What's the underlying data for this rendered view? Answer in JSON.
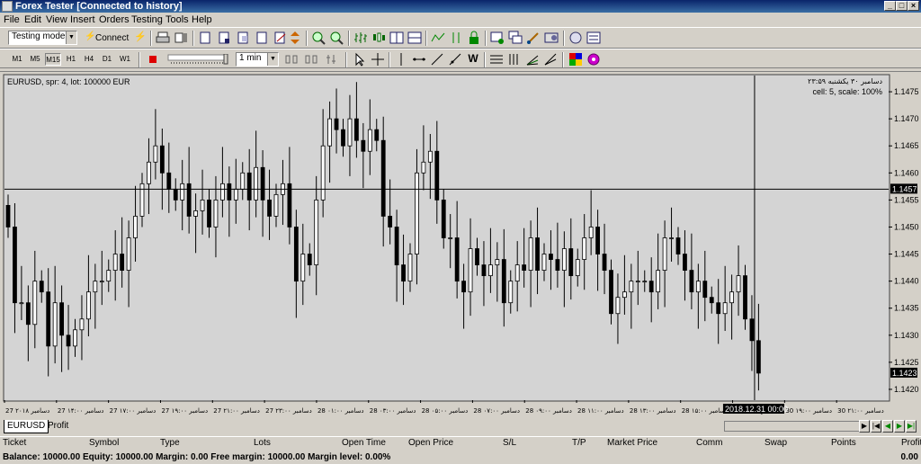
{
  "window": {
    "title": "Forex Tester [Connected to history]"
  },
  "menu": [
    "File",
    "Edit",
    "View",
    "Insert",
    "Orders",
    "Testing",
    "Tools",
    "Help"
  ],
  "toolbar": {
    "mode_select": "Testing mode",
    "connect_label": "Connect",
    "timeframes": [
      "M1",
      "M5",
      "M15",
      "H1",
      "H4",
      "D1",
      "W1"
    ],
    "active_timeframe": "M15",
    "speed_select": "1 min"
  },
  "chart": {
    "info_line": "EURUSD, spr: 4, lot: 100000 EUR",
    "cursor_date_line": "دسامبر ۳۰ یکشنبه ۲۳:۵۹",
    "cell_scale": "cell: 5, scale: 100%",
    "crosshair_price": "1.1457",
    "last_price": "1.1423",
    "crosshair_time": "2018.12.31 00:00",
    "colors": {
      "background": "#d4d4d4",
      "bull": "#ffffff",
      "bear": "#000000",
      "crosshair": "#000000"
    }
  },
  "chart_data": {
    "type": "candlestick",
    "symbol": "EURUSD",
    "ylim": [
      1.1418,
      1.1478
    ],
    "y_ticks": [
      "1.1475",
      "1.1470",
      "1.1465",
      "1.1460",
      "1.1455",
      "1.1450",
      "1.1445",
      "1.1440",
      "1.1435",
      "1.1430",
      "1.1425",
      "1.1420"
    ],
    "x_ticks": [
      "27 دسامبر ۲۰۱۸",
      "27 دسامبر ۱۴:۰۰",
      "27 دسامبر ۱۷:۰۰",
      "27 دسامبر ۱۹:۰۰",
      "27 دسامبر ۲۱:۰۰",
      "27 دسامبر ۲۳:۰۰",
      "28 دسامبر ۰۱:۰۰",
      "28 دسامبر ۰۳:۰۰",
      "28 دسامبر ۰۵:۰۰",
      "28 دسامبر ۰۷:۰۰",
      "28 دسامبر ۰۹:۰۰",
      "28 دسامبر ۱۱:۰۰",
      "28 دسامبر ۱۳:۰۰",
      "28 دسامبر ۱۵:۰۰",
      "30 دسامبر ۱۷:۰۰",
      "30 دسامبر ۱۹:۰۰",
      "30 دسامبر ۲۱:۰۰"
    ],
    "closes": [
      1.145,
      1.1436,
      1.1436,
      1.1432,
      1.144,
      1.1438,
      1.1428,
      1.1436,
      1.143,
      1.1428,
      1.1431,
      1.1433,
      1.1438,
      1.144,
      1.144,
      1.1442,
      1.1445,
      1.1442,
      1.1448,
      1.1452,
      1.1458,
      1.1462,
      1.1465,
      1.146,
      1.1457,
      1.1455,
      1.1458,
      1.1452,
      1.1453,
      1.1455,
      1.145,
      1.1455,
      1.1458,
      1.1455,
      1.1457,
      1.146,
      1.1455,
      1.1461,
      1.1455,
      1.1452,
      1.1456,
      1.1458,
      1.145,
      1.144,
      1.1445,
      1.1443,
      1.1455,
      1.1465,
      1.147,
      1.1468,
      1.1465,
      1.147,
      1.1466,
      1.1464,
      1.1468,
      1.1466,
      1.1452,
      1.145,
      1.1443,
      1.144,
      1.1445,
      1.146,
      1.1462,
      1.1464,
      1.1455,
      1.1448,
      1.1448,
      1.144,
      1.1438,
      1.1446,
      1.1443,
      1.1441,
      1.1443,
      1.1444,
      1.1436,
      1.144,
      1.1443,
      1.1442,
      1.1448,
      1.1442,
      1.1445,
      1.1444,
      1.1442,
      1.1446,
      1.1441,
      1.1444,
      1.1448,
      1.145,
      1.1445,
      1.1442,
      1.1434,
      1.1437,
      1.1438,
      1.144,
      1.144,
      1.144,
      1.1438,
      1.1442,
      1.1448,
      1.1448,
      1.1445,
      1.1442,
      1.1438,
      1.144,
      1.1437,
      1.1436,
      1.1434,
      1.1436,
      1.1438,
      1.1441,
      1.1433,
      1.1429,
      1.1423
    ]
  },
  "tabs": [
    "EURUSD",
    "Profit"
  ],
  "orders_columns": [
    "Ticket",
    "Symbol",
    "Type",
    "Lots",
    "Open Time",
    "Open Price",
    "S/L",
    "T/P",
    "Market Price",
    "Comm",
    "Swap",
    "Points",
    "Profit"
  ],
  "status": {
    "text": "Balance: 10000.00 Equity: 10000.00 Margin: 0.00 Free margin: 10000.00 Margin level: 0.00%",
    "profit": "0.00"
  }
}
